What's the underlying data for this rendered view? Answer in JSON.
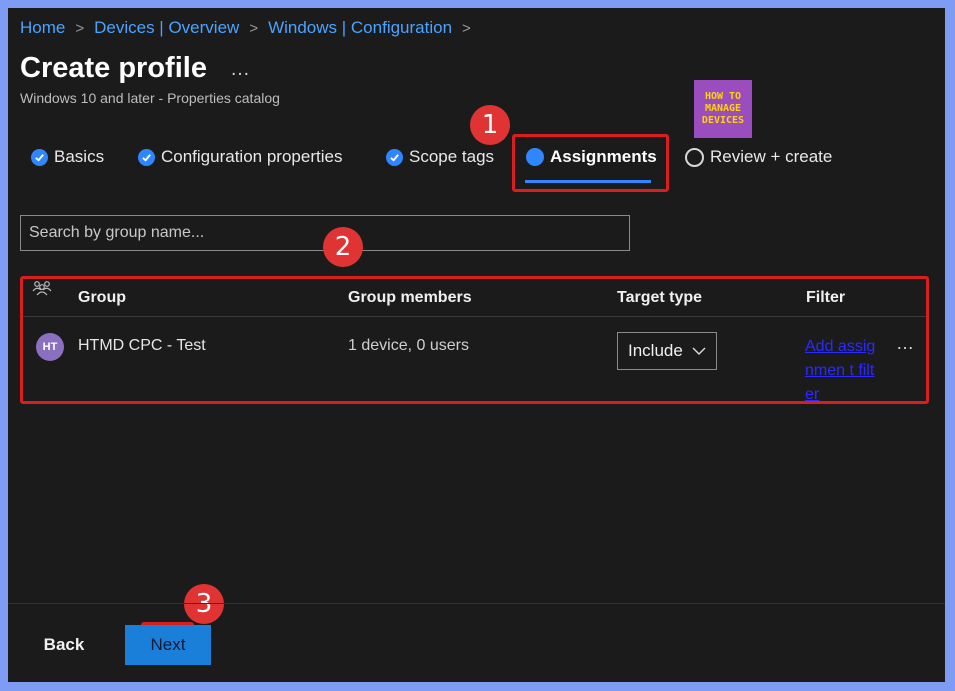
{
  "breadcrumb": {
    "items": [
      "Home",
      "Devices | Overview",
      "Windows | Configuration"
    ],
    "separator": ">"
  },
  "page": {
    "title": "Create profile",
    "more": "…",
    "subtitle": "Windows 10 and later - Properties catalog"
  },
  "logo": {
    "lines": [
      "HOW TO",
      "MANAGE",
      "DEVICES"
    ]
  },
  "tabs": [
    {
      "label": "Basics",
      "state": "completed"
    },
    {
      "label": "Configuration properties",
      "state": "completed"
    },
    {
      "label": "Scope tags",
      "state": "completed"
    },
    {
      "label": "Assignments",
      "state": "active"
    },
    {
      "label": "Review + create",
      "state": "pending"
    }
  ],
  "search": {
    "placeholder": "Search by group name...",
    "value": ""
  },
  "table": {
    "headers": {
      "group": "Group",
      "members": "Group members",
      "target": "Target type",
      "filter": "Filter"
    },
    "rows": [
      {
        "initials": "HT",
        "group": "HTMD CPC - Test",
        "members": "1 device, 0 users",
        "target": "Include",
        "filter_link": "Add assignmen t filter",
        "more": "…"
      }
    ]
  },
  "annotations": {
    "step1": "1",
    "step2": "2",
    "step3": "3"
  },
  "footer": {
    "back_label": "Back",
    "next_label": "Next"
  },
  "colors": {
    "accent": "#2f86ff",
    "highlight": "#d81e1e",
    "badge": "#e03434",
    "link": "#4aa3ff"
  }
}
